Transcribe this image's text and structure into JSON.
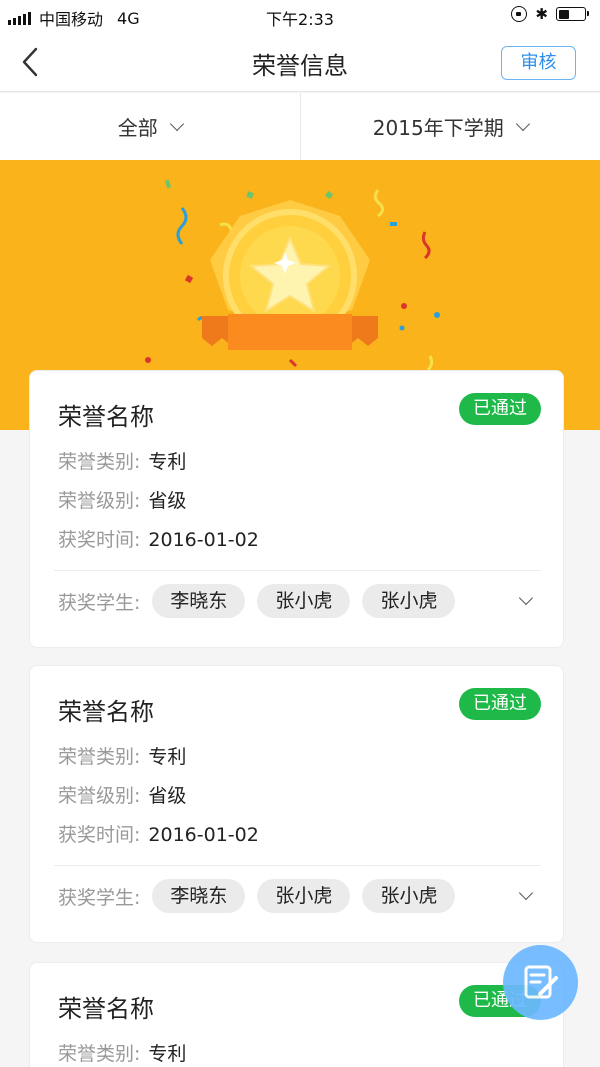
{
  "status_bar": {
    "carrier": "中国移动",
    "network": "4G",
    "time": "下午2:33"
  },
  "nav": {
    "title": "荣誉信息",
    "audit_label": "审核"
  },
  "filters": {
    "category": "全部",
    "term": "2015年下学期"
  },
  "labels": {
    "category": "荣誉类别:",
    "level": "荣誉级别:",
    "time": "获奖时间:",
    "students": "获奖学生:"
  },
  "cards": [
    {
      "name": "荣誉名称",
      "status": "已通过",
      "category": "专利",
      "level": "省级",
      "date": "2016-01-02",
      "students": [
        "李晓东",
        "张小虎",
        "张小虎"
      ]
    },
    {
      "name": "荣誉名称",
      "status": "已通过",
      "category": "专利",
      "level": "省级",
      "date": "2016-01-02",
      "students": [
        "李晓东",
        "张小虎",
        "张小虎"
      ]
    },
    {
      "name": "荣誉名称",
      "status": "已通过",
      "category": "专利"
    }
  ],
  "colors": {
    "banner": "#fbb31b",
    "status_badge": "#1fb94a",
    "audit_button": "#2f8fe8",
    "fab": "#6cb8ff"
  },
  "icons": {
    "back": "chevron-left-icon",
    "dropdown": "chevron-down-icon",
    "medal": "medal-star-icon",
    "fab": "edit-icon"
  }
}
